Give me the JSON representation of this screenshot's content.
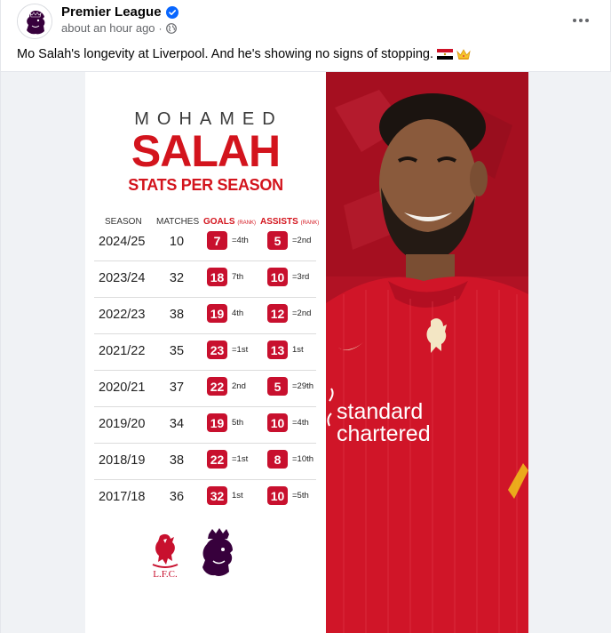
{
  "post": {
    "page_name": "Premier League",
    "timestamp": "about an hour ago",
    "separator": "·",
    "caption": "Mo Salah's longevity at Liverpool. And he's showing no signs of stopping.",
    "icons": [
      "premier-league-lion-avatar",
      "verified-badge-icon",
      "globe-icon",
      "more-options-icon",
      "egypt-flag-emoji",
      "crown-emoji"
    ]
  },
  "graphic": {
    "first_name": "MOHAMED",
    "last_name": "SALAH",
    "subtitle": "STATS PER SEASON",
    "headers": {
      "season": "SEASON",
      "matches": "MATCHES",
      "goals": "GOALS",
      "goals_rank": "(RANK)",
      "assists": "ASSISTS",
      "assists_rank": "(RANK)"
    },
    "rows": [
      {
        "season": "2024/25",
        "matches": "10",
        "goals": "7",
        "goals_rank": "=4th",
        "assists": "5",
        "assists_rank": "=2nd"
      },
      {
        "season": "2023/24",
        "matches": "32",
        "goals": "18",
        "goals_rank": "7th",
        "assists": "10",
        "assists_rank": "=3rd"
      },
      {
        "season": "2022/23",
        "matches": "38",
        "goals": "19",
        "goals_rank": "4th",
        "assists": "12",
        "assists_rank": "=2nd"
      },
      {
        "season": "2021/22",
        "matches": "35",
        "goals": "23",
        "goals_rank": "=1st",
        "assists": "13",
        "assists_rank": "1st"
      },
      {
        "season": "2020/21",
        "matches": "37",
        "goals": "22",
        "goals_rank": "2nd",
        "assists": "5",
        "assists_rank": "=29th"
      },
      {
        "season": "2019/20",
        "matches": "34",
        "goals": "19",
        "goals_rank": "5th",
        "assists": "10",
        "assists_rank": "=4th"
      },
      {
        "season": "2018/19",
        "matches": "38",
        "goals": "22",
        "goals_rank": "=1st",
        "assists": "8",
        "assists_rank": "=10th"
      },
      {
        "season": "2017/18",
        "matches": "36",
        "goals": "32",
        "goals_rank": "1st",
        "assists": "10",
        "assists_rank": "=5th"
      }
    ],
    "club_crest_text": "L.F.C.",
    "sponsor_line1": "standard",
    "sponsor_line2": "chartered",
    "colors": {
      "red": "#c8102e",
      "title_red": "#d3141d",
      "league_purple": "#37003c"
    }
  }
}
